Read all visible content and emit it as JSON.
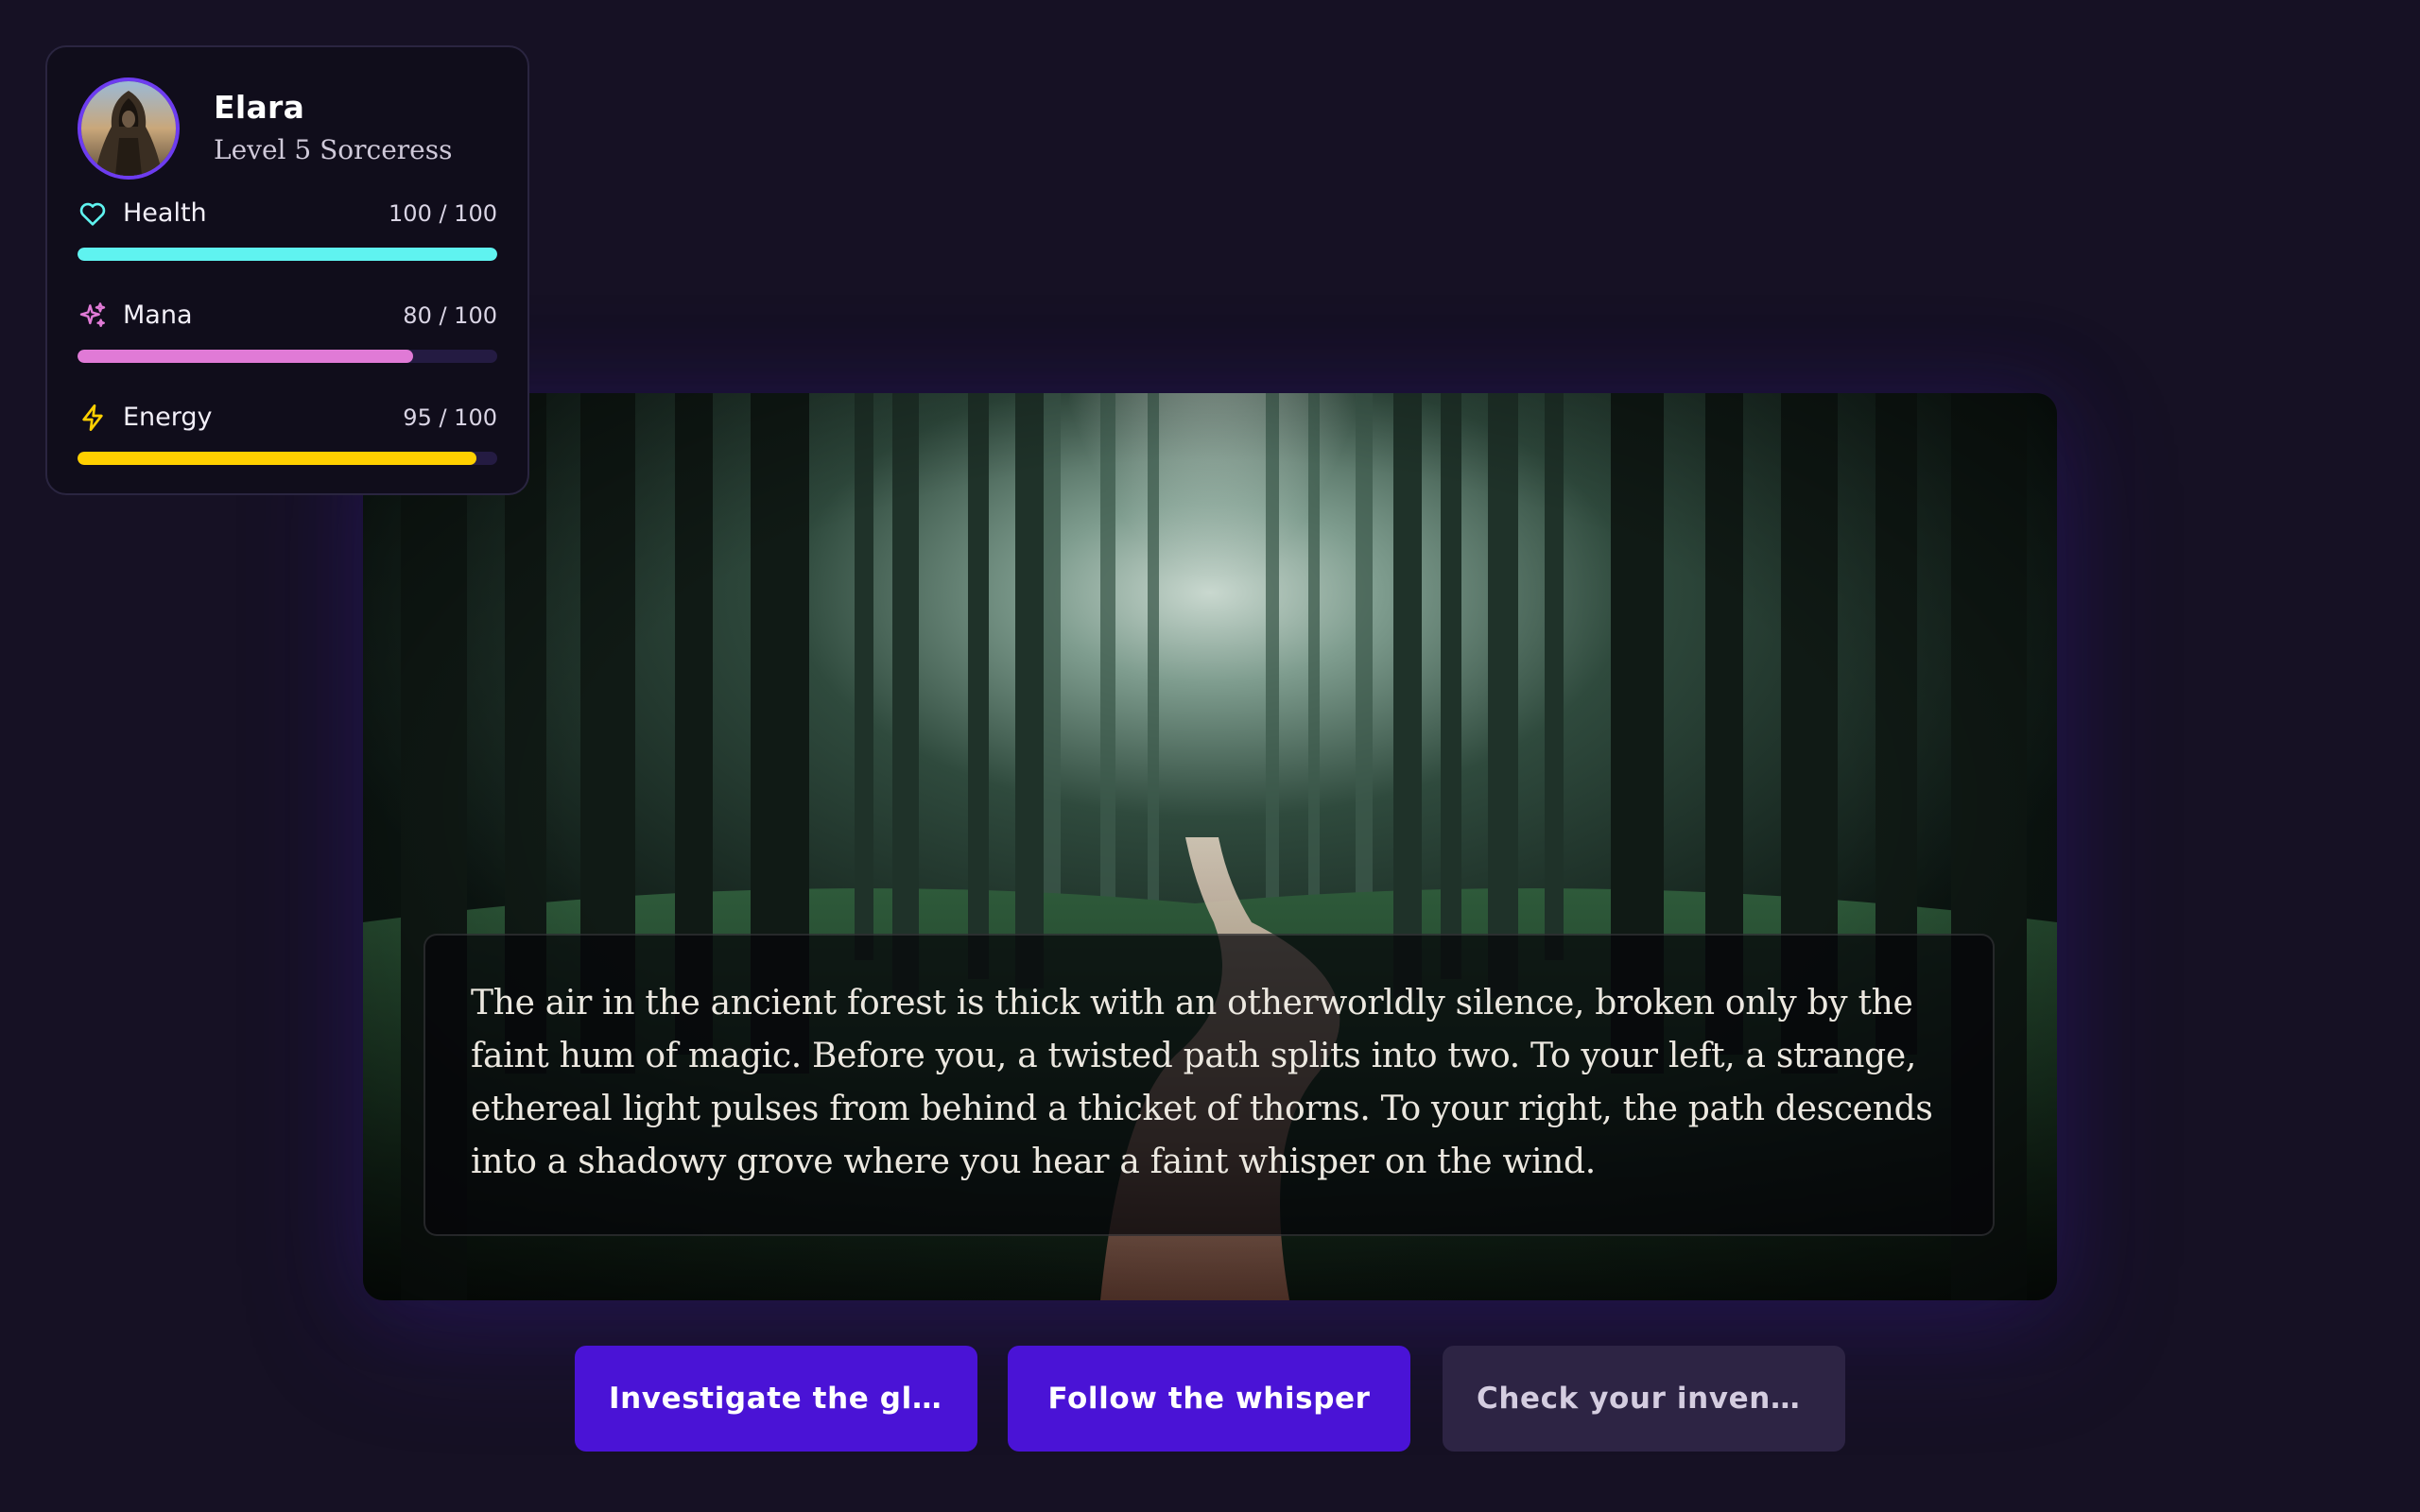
{
  "character": {
    "name": "Elara",
    "class": "Level 5 Sorceress",
    "avatar_icon": "hooded-sorceress-portrait"
  },
  "stats": [
    {
      "key": "health",
      "label": "Health",
      "value_text": "100 / 100",
      "current": 100,
      "max": 100,
      "icon": "heart-icon",
      "color": "#5ff3f0"
    },
    {
      "key": "mana",
      "label": "Mana",
      "value_text": "80 / 100",
      "current": 80,
      "max": 100,
      "icon": "sparkles-icon",
      "color": "#e07ad6"
    },
    {
      "key": "energy",
      "label": "Energy",
      "value_text": "95 / 100",
      "current": 95,
      "max": 100,
      "icon": "lightning-icon",
      "color": "#ffd000"
    }
  ],
  "scene": {
    "image": "misty-forest-path",
    "narration": "The air in the ancient forest is thick with an otherworldly silence, broken only by the faint hum of magic. Before you, a twisted path splits into two. To your left, a strange, ethereal light pulses from behind a thicket of thorns. To your right, the path descends into a shadowy grove where you hear a faint whisper on the wind."
  },
  "choices": [
    {
      "label": "Investigate the glow",
      "style": "primary"
    },
    {
      "label": "Follow the whisper",
      "style": "primary"
    },
    {
      "label": "Check your invento...",
      "style": "secondary"
    }
  ],
  "colors": {
    "background": "#161124",
    "primary_button": "#4a13d6",
    "secondary_button": "#2d2444",
    "avatar_ring": "#6d3cf0"
  }
}
